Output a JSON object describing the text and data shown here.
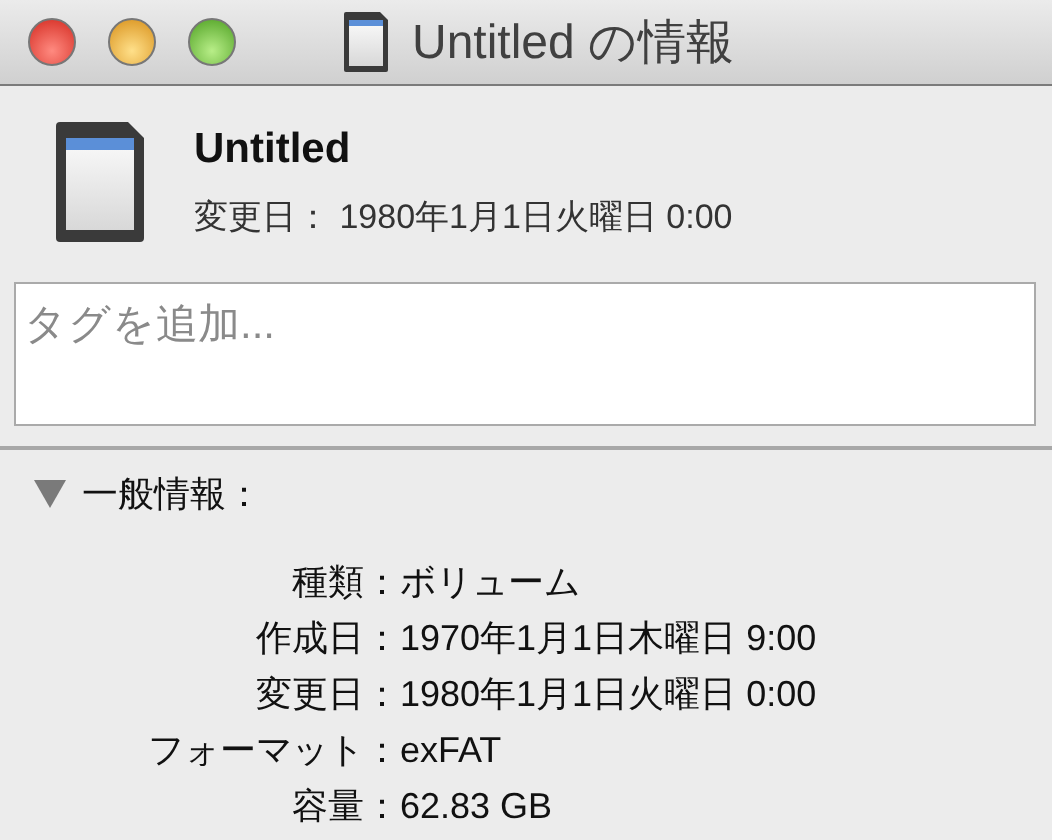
{
  "window": {
    "title": "Untitled の情報"
  },
  "header": {
    "name": "Untitled",
    "modified": "変更日：  1980年1月1日火曜日 0:00"
  },
  "tags": {
    "placeholder": "タグを追加..."
  },
  "section": {
    "title": "一般情報：",
    "expanded": true,
    "rows": [
      {
        "label": "種類：",
        "value": "ボリューム"
      },
      {
        "label": "作成日：",
        "value": "1970年1月1日木曜日 9:00"
      },
      {
        "label": "変更日：",
        "value": "1980年1月1日火曜日 0:00"
      },
      {
        "label": "フォーマット：",
        "value": "exFAT"
      },
      {
        "label": "容量：",
        "value": "62.83 GB"
      }
    ]
  }
}
